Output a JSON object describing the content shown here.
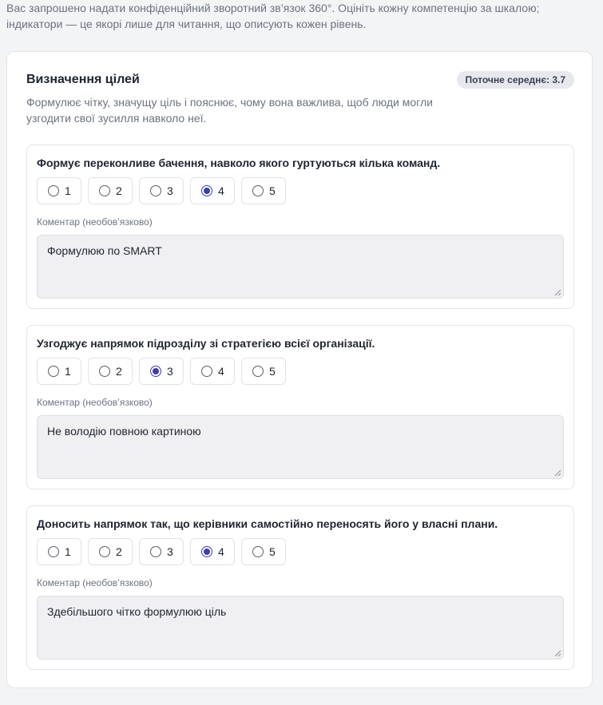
{
  "intro": {
    "line1": "Вас запрошено надати конфіденційний зворотний зв’язок 360°. Оцініть кожну компетенцію за шкалою;",
    "line2": "індикатори — це якорі лише для читання, що описують кожен рівень."
  },
  "competency": {
    "title": "Визначення цілей",
    "average_badge": "Поточне середнє: 3.7",
    "description": "Формулює чітку, значущу ціль і пояснює, чому вона важлива, щоб люди могли узгодити свої зусилля навколо неї.",
    "comment_label": "Коментар (необов’язково)",
    "scale": [
      "1",
      "2",
      "3",
      "4",
      "5"
    ],
    "indicators": [
      {
        "text": "Формує переконливе бачення, навколо якого гуртуються кілька команд.",
        "selected": 4,
        "comment": "Формулюю по SMART"
      },
      {
        "text": "Узгоджує напрямок підрозділу зі стратегією всієї організації.",
        "selected": 3,
        "comment": "Не володію повною картиною"
      },
      {
        "text": "Доносить напрямок так, що керівники самостійно переносять його у власні плани.",
        "selected": 4,
        "comment": "Здебільшого чітко формулюю ціль"
      }
    ]
  },
  "colors": {
    "accent": "#3d3db0",
    "badge_bg": "#e6e8ee",
    "page_bg": "#f3f4f6"
  }
}
